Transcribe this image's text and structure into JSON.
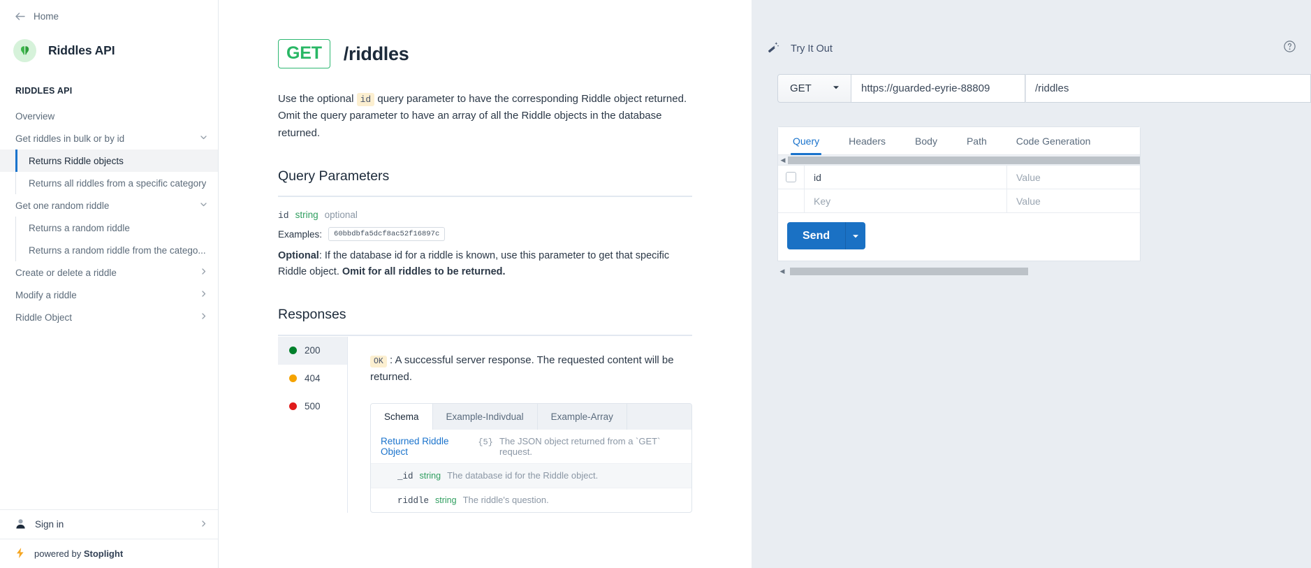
{
  "sidebar": {
    "home_label": "Home",
    "brand_title": "Riddles API",
    "section_title": "RIDDLES API",
    "items": [
      {
        "label": "Overview",
        "type": "top",
        "chevron": "",
        "active": false
      },
      {
        "label": "Get riddles in bulk or by id",
        "type": "top",
        "chevron": "chevron-down",
        "active": false
      },
      {
        "label": "Returns Riddle objects",
        "type": "sub",
        "chevron": "",
        "active": true
      },
      {
        "label": "Returns all riddles from a specific category",
        "type": "sub",
        "chevron": "",
        "active": false
      },
      {
        "label": "Get one random riddle",
        "type": "top",
        "chevron": "chevron-down",
        "active": false
      },
      {
        "label": "Returns a random riddle",
        "type": "sub",
        "chevron": "",
        "active": false
      },
      {
        "label": "Returns a random riddle from the catego...",
        "type": "sub",
        "chevron": "",
        "active": false
      },
      {
        "label": "Create or delete a riddle",
        "type": "top",
        "chevron": "chevron-right",
        "active": false
      },
      {
        "label": "Modify a riddle",
        "type": "top",
        "chevron": "chevron-right",
        "active": false
      },
      {
        "label": "Riddle Object",
        "type": "top",
        "chevron": "chevron-right",
        "active": false
      }
    ],
    "signin_label": "Sign in",
    "powered_prefix": "powered by ",
    "powered_brand": "Stoplight"
  },
  "main": {
    "method": "GET",
    "path": "/riddles",
    "description_part1": "Use the optional ",
    "description_code": "id",
    "description_part2": " query parameter to have the corresponding Riddle object returned. Omit the query parameter to have an array of all the Riddle objects in the database returned.",
    "query_params_title": "Query Parameters",
    "param": {
      "name": "id",
      "type": "string",
      "requirement": "optional",
      "examples_label": "Examples:",
      "example_value": "60bbdbfa5dcf8ac52f16897c",
      "note_bold_lead": "Optional",
      "note_rest": ": If the database id for a riddle is known, use this parameter to get that specific Riddle object. ",
      "note_bold_tail": "Omit for all riddles to be returned."
    },
    "responses_title": "Responses",
    "response_codes": [
      {
        "code": "200",
        "color": "#00802b",
        "active": true
      },
      {
        "code": "404",
        "color": "#f5a300",
        "active": false
      },
      {
        "code": "500",
        "color": "#e01b1b",
        "active": false
      }
    ],
    "response_chip": "OK",
    "response_text": " : A successful server response. The requested content will be returned.",
    "schema_tabs": [
      {
        "label": "Schema",
        "active": true
      },
      {
        "label": "Example-Indivdual",
        "active": false
      },
      {
        "label": "Example-Array",
        "active": false
      }
    ],
    "schema_root": {
      "link": "Returned Riddle Object",
      "count": "{5}",
      "desc": "The JSON object returned from a `GET` request."
    },
    "schema_rows": [
      {
        "name": "_id",
        "type": "string",
        "desc": "The database id for the Riddle object."
      },
      {
        "name": "riddle",
        "type": "string",
        "desc": "The riddle's question."
      }
    ]
  },
  "tryit": {
    "title": "Try It Out",
    "method": "GET",
    "url": "https://guarded-eyrie-88809",
    "path": "/riddles",
    "tabs": [
      {
        "label": "Query",
        "active": true
      },
      {
        "label": "Headers",
        "active": false
      },
      {
        "label": "Body",
        "active": false
      },
      {
        "label": "Path",
        "active": false
      },
      {
        "label": "Code Generation",
        "active": false
      }
    ],
    "param_rows": [
      {
        "key": "id",
        "key_is_placeholder": false,
        "value": "Value",
        "value_is_placeholder": true,
        "has_checkbox": true
      },
      {
        "key": "Key",
        "key_is_placeholder": true,
        "value": "Value",
        "value_is_placeholder": true,
        "has_checkbox": false
      }
    ],
    "send_label": "Send"
  },
  "colors": {
    "accent_blue": "#1a73cc",
    "method_green": "#29b765",
    "send_blue": "#1a71c4",
    "panel_bg": "#e9edf2",
    "code_bg": "#fcefd0"
  }
}
